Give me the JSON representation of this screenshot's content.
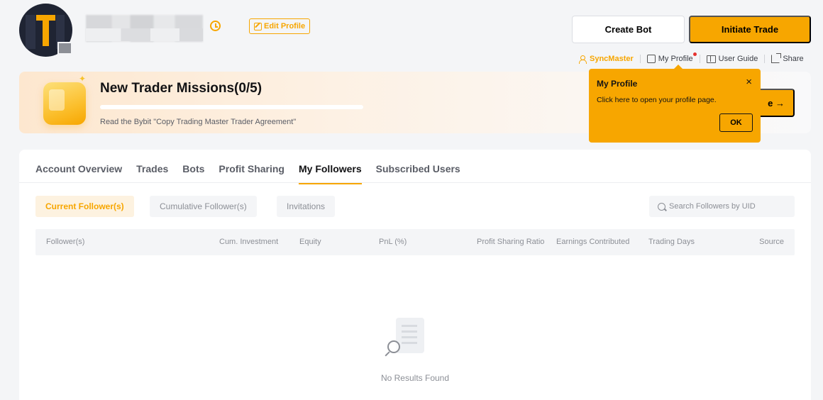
{
  "header": {
    "edit_profile_label": "Edit Profile",
    "create_bot_label": "Create Bot",
    "initiate_trade_label": "Initiate Trade",
    "links": [
      {
        "label": "SyncMaster"
      },
      {
        "label": "My Profile"
      },
      {
        "label": "User Guide"
      },
      {
        "label": "Share"
      }
    ]
  },
  "missions": {
    "title": "New Trader Missions(0/5)",
    "subtitle": "Read the Bybit \"Copy Trading Master Trader Agreement\"",
    "progress_fraction": 0,
    "button_suffix": "e →"
  },
  "popover": {
    "title": "My Profile",
    "body": "Click here to open your profile page.",
    "ok_label": "OK",
    "close_symbol": "×"
  },
  "tabs": [
    {
      "label": "Account Overview",
      "active": false
    },
    {
      "label": "Trades",
      "active": false
    },
    {
      "label": "Bots",
      "active": false
    },
    {
      "label": "Profit Sharing",
      "active": false
    },
    {
      "label": "My Followers",
      "active": true
    },
    {
      "label": "Subscribed Users",
      "active": false
    }
  ],
  "segments": [
    {
      "label": "Current Follower(s)",
      "active": true
    },
    {
      "label": "Cumulative Follower(s)",
      "active": false
    },
    {
      "label": "Invitations",
      "active": false
    }
  ],
  "search": {
    "placeholder": "Search Followers by UID"
  },
  "table": {
    "columns": [
      "Follower(s)",
      "Cum. Investment",
      "Equity",
      "PnL (%)",
      "Profit Sharing Ratio",
      "Earnings Contributed",
      "Trading Days",
      "Source"
    ]
  },
  "empty_state": {
    "text": "No Results Found"
  },
  "colors": {
    "accent": "#f7a600",
    "text": "#121214",
    "muted": "#8c8f96"
  }
}
